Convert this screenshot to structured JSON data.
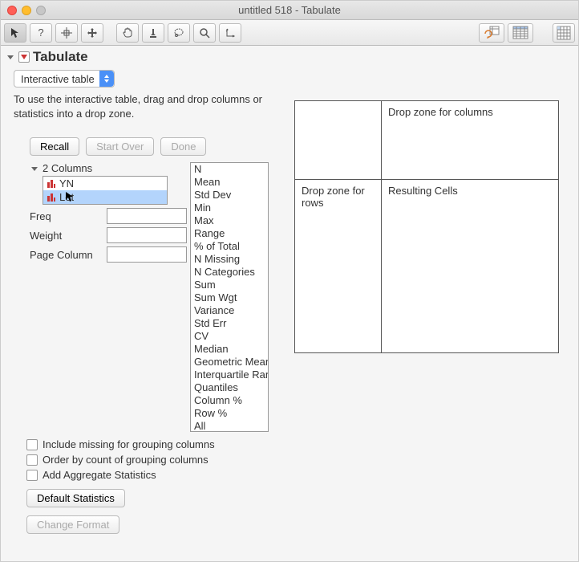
{
  "window": {
    "title": "untitled 518 - Tabulate"
  },
  "section": {
    "title": "Tabulate"
  },
  "mode_select": {
    "value": "Interactive table"
  },
  "instructions": "To use the interactive table, drag and drop columns or statistics into a drop zone.",
  "buttons": {
    "recall": "Recall",
    "start_over": "Start Over",
    "done": "Done",
    "default_stats": "Default Statistics",
    "change_format": "Change Format"
  },
  "columns": {
    "header": "2 Columns",
    "items": [
      {
        "name": "YN"
      },
      {
        "name": "Lot"
      }
    ]
  },
  "fields": {
    "freq": {
      "label": "Freq",
      "value": ""
    },
    "weight": {
      "label": "Weight",
      "value": ""
    },
    "page_column": {
      "label": "Page Column",
      "value": ""
    }
  },
  "statistics": [
    "N",
    "Mean",
    "Std Dev",
    "Min",
    "Max",
    "Range",
    "% of Total",
    "N Missing",
    "N Categories",
    "Sum",
    "Sum Wgt",
    "Variance",
    "Std Err",
    "CV",
    "Median",
    "Geometric Mean",
    "Interquartile Range",
    "Quantiles",
    "Column %",
    "Row %",
    "All"
  ],
  "checks": {
    "include_missing": "Include missing for grouping columns",
    "order_by_count": "Order by count of grouping columns",
    "add_agg": "Add Aggregate Statistics"
  },
  "dropzones": {
    "cols": "Drop zone for columns",
    "rows": "Drop zone for rows",
    "result": "Resulting Cells"
  }
}
